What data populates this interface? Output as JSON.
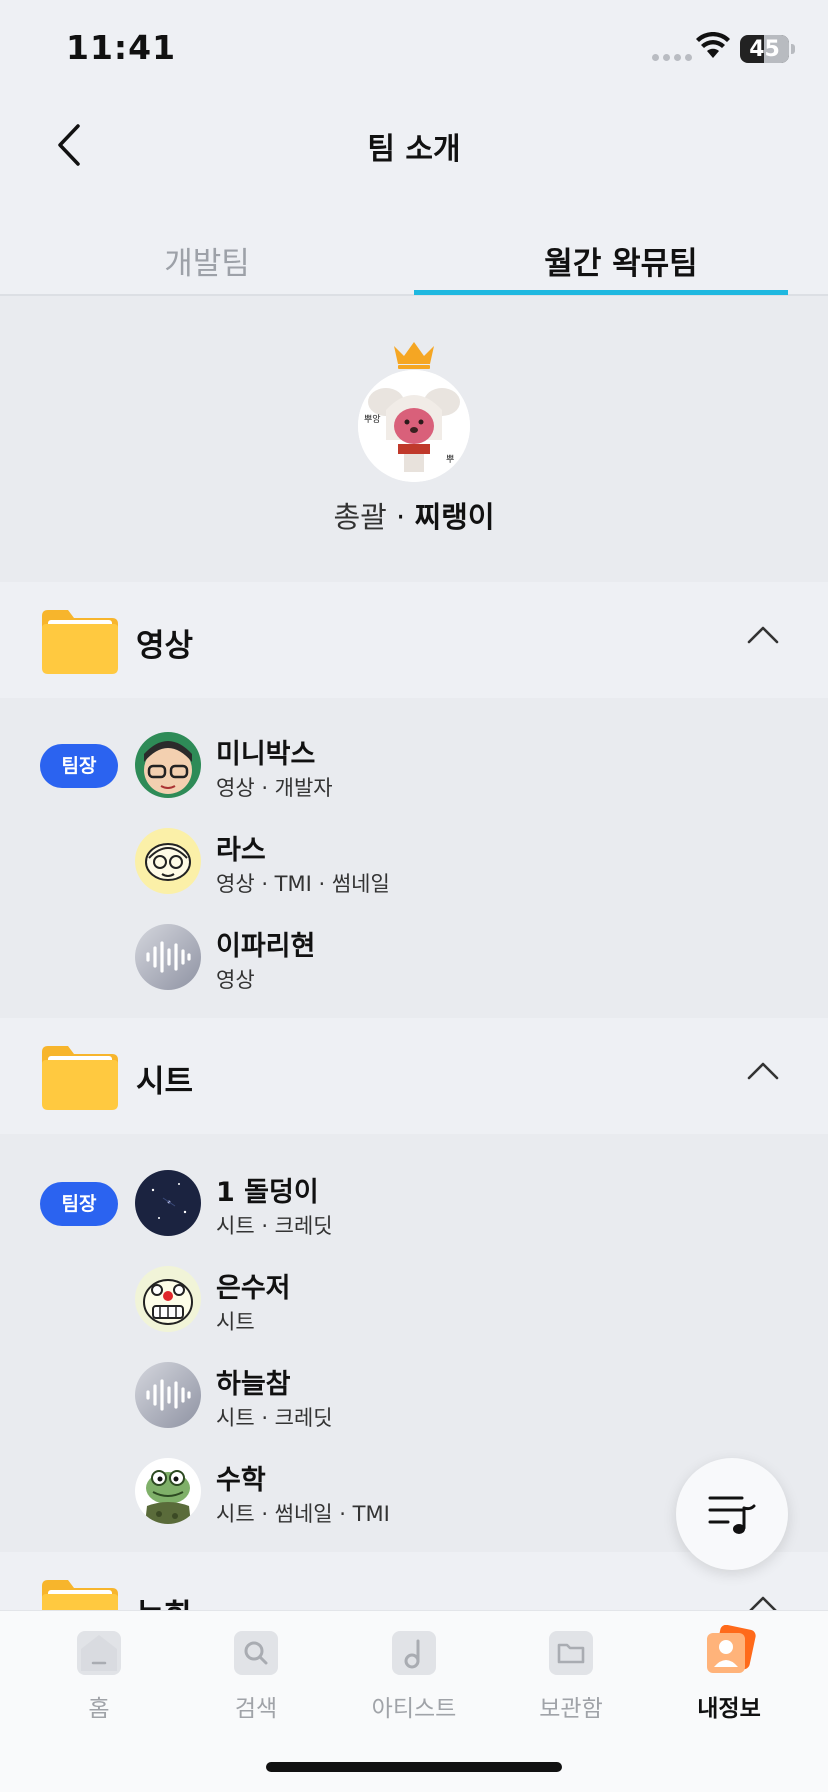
{
  "status": {
    "time": "11:41",
    "battery": "45"
  },
  "header": {
    "title": "팀 소개"
  },
  "tabs": [
    {
      "label": "개발팀",
      "active": false
    },
    {
      "label": "월간 왁뮤팀",
      "active": true
    }
  ],
  "leader": {
    "role": "총괄",
    "separator": "·",
    "name": "찌랭이"
  },
  "categories": [
    {
      "name": "영상",
      "members": [
        {
          "name": "미니박스",
          "desc": "영상 · 개발자",
          "badge": "팀장"
        },
        {
          "name": "라스",
          "desc": "영상 · TMI · 썸네일"
        },
        {
          "name": "이파리현",
          "desc": "영상"
        }
      ]
    },
    {
      "name": "시트",
      "members": [
        {
          "name": "1 돌덩이",
          "desc": "시트 · 크레딧",
          "badge": "팀장"
        },
        {
          "name": "은수저",
          "desc": "시트"
        },
        {
          "name": "하늘참",
          "desc": "시트 · 크레딧"
        },
        {
          "name": "수학",
          "desc": "시트 · 썸네일 · TMI"
        }
      ]
    },
    {
      "name": "녹화"
    }
  ],
  "tabbar": [
    {
      "label": "홈",
      "icon": "home-icon"
    },
    {
      "label": "검색",
      "icon": "search-icon"
    },
    {
      "label": "아티스트",
      "icon": "artist-icon"
    },
    {
      "label": "보관함",
      "icon": "folder-icon"
    },
    {
      "label": "내정보",
      "icon": "profile-icon",
      "active": true
    }
  ],
  "colors": {
    "accent": "#1fb8e0",
    "badge": "#2b63f0",
    "folder": "#ffc940"
  }
}
